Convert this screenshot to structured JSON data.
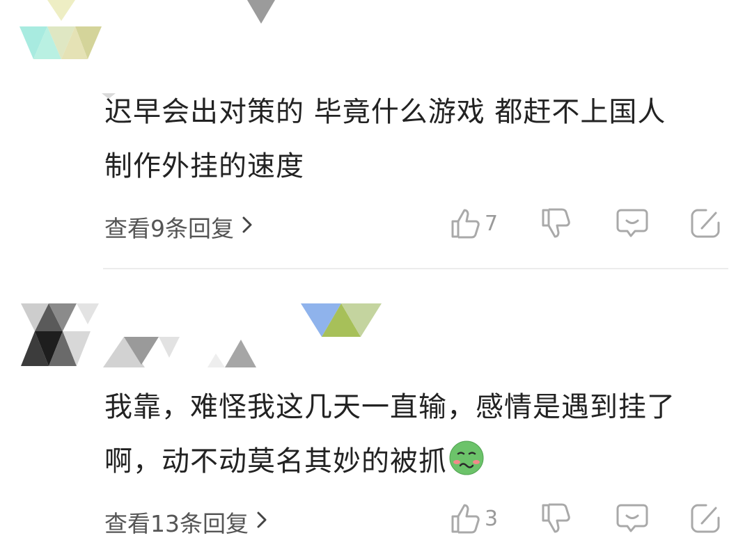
{
  "comments": [
    {
      "text_line1": "迟早会出对策的 毕竟什么游戏 都赶不上国人",
      "text_line2": "制作外挂的速度",
      "replies_label": "查看9条回复",
      "likes": "7"
    },
    {
      "text_line1": "我靠，难怪我这几天一直输，感情是遇到挂了",
      "text_line2": "啊，动不动莫名其妙的被抓",
      "replies_label": "查看13条回复",
      "likes": "3"
    }
  ],
  "icons": {
    "like": "thumbs-up-icon",
    "dislike": "thumbs-down-icon",
    "comment": "speech-bubble-icon",
    "share": "edit-share-icon",
    "chevron": "chevron-right-icon",
    "emoji": "nauseated-face-emoji"
  },
  "colors": {
    "text": "#222222",
    "secondary": "#555555",
    "icon": "#a9a9a9",
    "divider": "#ececec"
  }
}
